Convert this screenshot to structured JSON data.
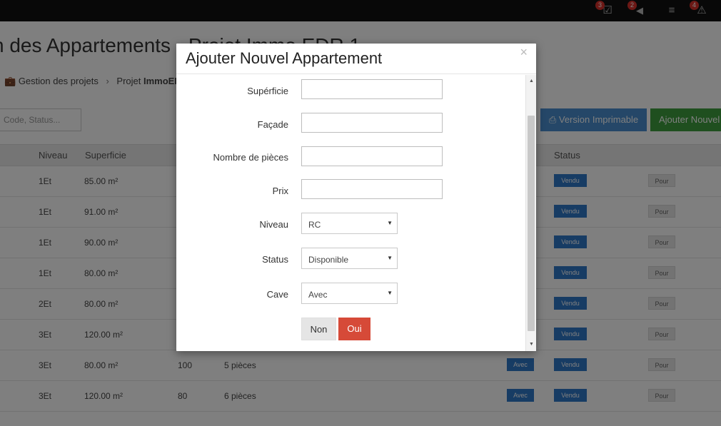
{
  "topbar": {
    "icons": [
      {
        "name": "tasks-icon",
        "glyph": "☑",
        "badge": "3"
      },
      {
        "name": "megaphone-icon",
        "glyph": "📢",
        "badge": "2"
      },
      {
        "name": "menu-icon",
        "glyph": "≡",
        "badge": ""
      },
      {
        "name": "alert-icon",
        "glyph": "⚠",
        "badge": "4"
      }
    ]
  },
  "page": {
    "title": "n des Appartements - Projet Immo EDR 1",
    "breadcrumb": {
      "home": "Gestion des projets",
      "current_prefix": "Projet ",
      "current_bold": "ImmoER"
    },
    "search_placeholder": "Code, Status...",
    "print_button": "Version Imprimable",
    "add_button": "Ajouter Nouvel"
  },
  "table": {
    "headers": {
      "niveau": "Niveau",
      "superficie": "Superficie",
      "status": "Status"
    },
    "rows": [
      {
        "niveau": "1Et",
        "superficie": "85.00 m²",
        "facade": "",
        "pieces": "",
        "cave": "",
        "status": "Vendu",
        "action": "Pour"
      },
      {
        "niveau": "1Et",
        "superficie": "91.00 m²",
        "facade": "",
        "pieces": "",
        "cave": "",
        "status": "Vendu",
        "action": "Pour"
      },
      {
        "niveau": "1Et",
        "superficie": "90.00 m²",
        "facade": "",
        "pieces": "",
        "cave": "",
        "status": "Vendu",
        "action": "Pour"
      },
      {
        "niveau": "1Et",
        "superficie": "80.00 m²",
        "facade": "",
        "pieces": "",
        "cave": "",
        "status": "Vendu",
        "action": "Pour"
      },
      {
        "niveau": "2Et",
        "superficie": "80.00 m²",
        "facade": "",
        "pieces": "",
        "cave": "",
        "status": "Vendu",
        "action": "Pour"
      },
      {
        "niveau": "3Et",
        "superficie": "120.00 m²",
        "facade": "",
        "pieces": "",
        "cave": "",
        "status": "Vendu",
        "action": "Pour"
      },
      {
        "niveau": "3Et",
        "superficie": "80.00 m²",
        "facade": "100",
        "pieces": "5 pièces",
        "cave": "Avec",
        "status": "Vendu",
        "action": "Pour"
      },
      {
        "niveau": "3Et",
        "superficie": "120.00 m²",
        "facade": "80",
        "pieces": "6 pièces",
        "cave": "Avec",
        "status": "Vendu",
        "action": "Pour"
      }
    ]
  },
  "modal": {
    "title": "Ajouter Nouvel Appartement",
    "close": "×",
    "fields": {
      "superficie": {
        "label": "Supérficie",
        "value": ""
      },
      "facade": {
        "label": "Façade",
        "value": ""
      },
      "pieces": {
        "label": "Nombre de pièces",
        "value": ""
      },
      "prix": {
        "label": "Prix",
        "value": ""
      },
      "niveau": {
        "label": "Niveau",
        "value": "RC"
      },
      "status": {
        "label": "Status",
        "value": "Disponible"
      },
      "cave": {
        "label": "Cave",
        "value": "Avec"
      }
    },
    "cancel_button": "Non",
    "confirm_button": "Oui"
  },
  "colors": {
    "overlay": "rgba(0,0,0,0.5)",
    "primary": "#4a8fd0",
    "success": "#3f9f3f",
    "danger": "#d64a38",
    "status_blue": "#2f78c8"
  }
}
